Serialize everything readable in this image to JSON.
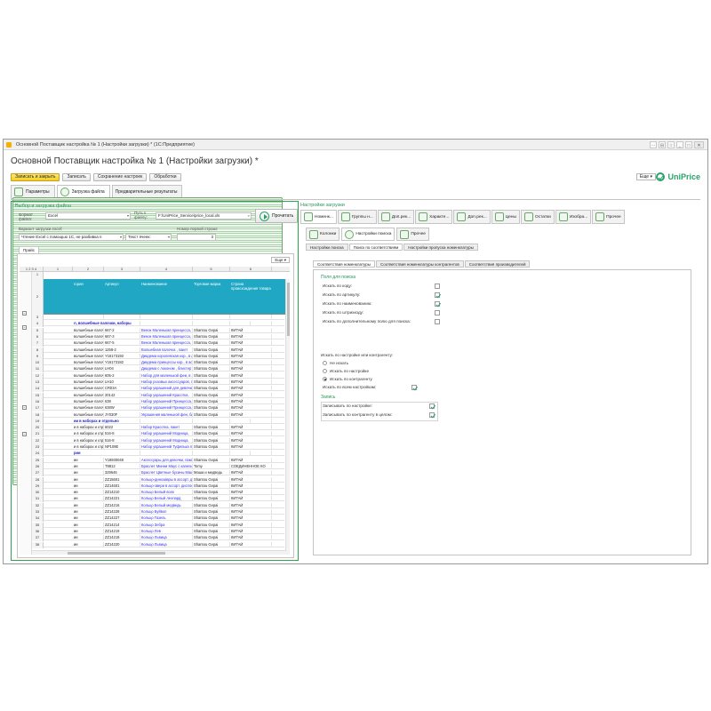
{
  "window": {
    "title": "Основной Поставщик настройка № 1 (Настройки загрузки) * (1С:Предприятие)",
    "controls": [
      "⋯",
      "⊟",
      "☆",
      "_",
      "□",
      "✕"
    ]
  },
  "doc_title": "Основной Поставщик настройка № 1 (Настройки загрузки) *",
  "toolbar": {
    "save_close": "Записать и закрыть",
    "save": "Записать",
    "save_settings": "Сохранение настроек",
    "processing": "Обработки",
    "more": "Еще"
  },
  "logo": {
    "text": "UniPrice",
    "color": "#2aa36a"
  },
  "main_tabs": [
    {
      "label": "Параметры"
    },
    {
      "label": "Загрузка файла"
    },
    {
      "label": "Предварительные результаты"
    }
  ],
  "left": {
    "title": "Выбор и загрузка файла",
    "format_label": "Формат файла:",
    "format_value": "Excel",
    "path_label": "Путь к файлу:",
    "path_value": "F:\\UniPrice_Service\\price_local.xls",
    "load_button": "Прочитать",
    "variant_label": "Вариант загрузки excel:",
    "variant_value": "Чтение Excel с помощью 1С, не разбивка п",
    "text_label": "Текст ячеек:",
    "first_row_label": "Номер первой строки:",
    "first_row_value": "3",
    "sheet_tab": "Прайс",
    "more": "Еще",
    "col_headers": [
      "1",
      "2",
      "3",
      "4",
      "5",
      "6"
    ],
    "level_buttons": "1 2 3 4",
    "header_cells": [
      "гория",
      "Артикул",
      "Наименование",
      "Торговая марка",
      "Страна происхождения товара"
    ],
    "rows": [
      {
        "n": "1",
        "cells": [
          "",
          "",
          "",
          "",
          ""
        ]
      },
      {
        "n": "3",
        "cells": [
          "",
          "",
          "",
          "",
          ""
        ]
      },
      {
        "n": "4",
        "cells": [
          "л, волшебные палочки, наборы",
          "",
          "",
          "",
          ""
        ],
        "group": true
      },
      {
        "n": "5",
        "cells": [
          "волшебные палочк",
          "667-2",
          "Венок Маленькая принцесса,",
          "Shantou Gepai",
          "КИТАЙ"
        ]
      },
      {
        "n": "6",
        "cells": [
          "волшебные палочк",
          "667-3",
          "Венок Маленькая принцесса,",
          "Shantou Gepai",
          "КИТАЙ"
        ]
      },
      {
        "n": "7",
        "cells": [
          "волшебные палочк",
          "667-5",
          "Венок Маленькая принцесса,",
          "Shantou Gepai",
          "КИТАЙ"
        ]
      },
      {
        "n": "8",
        "cells": [
          "волшебные палочк",
          "1258-2",
          "Волшебная палочка , пакет",
          "Shantou Gepai",
          "КИТАЙ"
        ]
      },
      {
        "n": "9",
        "cells": [
          "волшебные палочк",
          "Y16173193",
          "Диадема королевская кор., в ассор",
          "Shantou Gepai",
          "КИТАЙ"
        ]
      },
      {
        "n": "10",
        "cells": [
          "волшебные палочк",
          "Y16173182",
          "Диадема принцессы кор., в ассор",
          "Shantou Gepai",
          "КИТАЙ"
        ]
      },
      {
        "n": "11",
        "cells": [
          "волшебные палочк",
          "LH04",
          "Диадема с локоном , блистер",
          "Shantou Gepai",
          "КИТАЙ"
        ]
      },
      {
        "n": "12",
        "cells": [
          "волшебные палочк",
          "605-2",
          "Набор для маленькой феи, в ассо",
          "Shantou Gepai",
          "КИТАЙ"
        ]
      },
      {
        "n": "13",
        "cells": [
          "волшебные палочк",
          "LH10",
          "Набор розовых аксессуаров, пакет",
          "Shantou Gepai",
          "КИТАЙ"
        ]
      },
      {
        "n": "14",
        "cells": [
          "волшебные палочк",
          "CR03A",
          "Набор украшений для девочки, бл",
          "Shantou Gepai",
          "КИТАЙ"
        ]
      },
      {
        "n": "15",
        "cells": [
          "волшебные палочк",
          "20142",
          "Набор украшений Красотка,",
          "Shantou Gepai",
          "КИТАЙ"
        ]
      },
      {
        "n": "16",
        "cells": [
          "волшебные палочк",
          "638",
          "Набор украшений Принцесса,",
          "Shantou Gepai",
          "КИТАЙ"
        ]
      },
      {
        "n": "17",
        "cells": [
          "волшебные палочк",
          "638W",
          "Набор украшений Принцесса,",
          "Shantou Gepai",
          "КИТАЙ"
        ]
      },
      {
        "n": "18",
        "cells": [
          "волшебные палочк",
          "JY030F",
          "Украшения маленькой феи, блист",
          "Shantou Gepai",
          "КИТАЙ"
        ]
      },
      {
        "n": "19",
        "cells": [
          "ии в наборах и отдельно",
          "",
          "",
          "",
          ""
        ],
        "group": true
      },
      {
        "n": "20",
        "cells": [
          "и в наборах и отдел",
          "6022",
          "Набор Красотка, пакет",
          "Shantou Gepai",
          "КИТАЙ"
        ]
      },
      {
        "n": "21",
        "cells": [
          "и в наборах и отдел",
          "516-8",
          "Набор украшений Модница,",
          "Shantou Gepai",
          "КИТАЙ"
        ]
      },
      {
        "n": "22",
        "cells": [
          "и в наборах и отдел",
          "516-8",
          "Набор украшений Модница,",
          "Shantou Gepai",
          "КИТАЙ"
        ]
      },
      {
        "n": "23",
        "cells": [
          "и в наборах и отдел",
          "NP109E",
          "Набор украшений Туфелька прин",
          "Shantou Gepai",
          "КИТАЙ"
        ]
      },
      {
        "n": "24",
        "cells": [
          "рии",
          "",
          "",
          "",
          ""
        ],
        "group": true
      },
      {
        "n": "25",
        "cells": [
          "ии",
          "Y18930048",
          "Аксессуары для девочки, пакет",
          "Shantou Gepai",
          "КИТАЙ"
        ]
      },
      {
        "n": "26",
        "cells": [
          "ии",
          "T8812",
          "Браслет Минни Маус с капелькой,",
          "Tomy",
          "СОЕДИНЕННОЕ КО"
        ]
      },
      {
        "n": "27",
        "cells": [
          "ии",
          "329646",
          "Браслет Цветные бусины Маша и",
          "Маша и медведь",
          "КИТАЙ"
        ]
      },
      {
        "n": "28",
        "cells": [
          "ии",
          "ZZ15601",
          "Кольцо-динозавры в ассорт. диспл",
          "Shantou Gepai",
          "КИТАЙ"
        ]
      },
      {
        "n": "29",
        "cells": [
          "ии",
          "ZZ14601",
          "Кольцо-звери в ассорт. дисплей, Ш",
          "Shantou Gepai",
          "КИТАЙ"
        ]
      },
      {
        "n": "30",
        "cells": [
          "ии",
          "ZZ14210",
          "Кольцо Белый волк",
          "Shantou Gepai",
          "КИТАЙ"
        ]
      },
      {
        "n": "31",
        "cells": [
          "ии",
          "ZZ14221",
          "Кольцо Белый леопард",
          "Shantou Gepai",
          "КИТАЙ"
        ]
      },
      {
        "n": "32",
        "cells": [
          "ии",
          "ZZ14216",
          "Кольцо Белый медведь",
          "Shantou Gepai",
          "КИТАЙ"
        ]
      },
      {
        "n": "33",
        "cells": [
          "ии",
          "ZZ14228",
          "Кольцо Буйвол",
          "Shantou Gepai",
          "КИТАЙ"
        ]
      },
      {
        "n": "34",
        "cells": [
          "ии",
          "ZZ14227",
          "Кольцо Газель",
          "Shantou Gepai",
          "КИТАЙ"
        ]
      },
      {
        "n": "35",
        "cells": [
          "ии",
          "ZZ14214",
          "Кольцо Зебра",
          "Shantou Gepai",
          "КИТАЙ"
        ]
      },
      {
        "n": "36",
        "cells": [
          "ии",
          "ZZ14219",
          "Кольцо Лев",
          "Shantou Gepai",
          "КИТАЙ"
        ]
      },
      {
        "n": "37",
        "cells": [
          "ии",
          "ZZ14218",
          "Кольцо Львица",
          "Shantou Gepai",
          "КИТАЙ"
        ]
      },
      {
        "n": "38",
        "cells": [
          "ии",
          "ZZ14220",
          "Кольцо Львица",
          "Shantou Gepai",
          "КИТАЙ"
        ]
      }
    ]
  },
  "right": {
    "title": "Настройки загрузки",
    "tabs": [
      "Номенк...",
      "Группы н...",
      "Доп.рек...",
      "Характе...",
      "Доп.рек...",
      "Цены",
      "Остатки",
      "Изобра...",
      "Прочее"
    ],
    "subtabs": [
      "Колонки",
      "Настройки поиска",
      "Прочее"
    ],
    "search_tabs": [
      "Настройки поиска",
      "Поиск по соответствиям",
      "Настройки пропуска номенклатуры"
    ],
    "match_tabs": [
      "Соответствия номенклатуры",
      "Соответствия номенклатуры контрагентов",
      "Соответствия производителей"
    ],
    "fields_head": "Поля для поиска",
    "checks": [
      {
        "label": "Искать по коду:",
        "on": false
      },
      {
        "label": "Искать по артикулу:",
        "on": true
      },
      {
        "label": "Искать по наименованию:",
        "on": true
      },
      {
        "label": "Искать по штрихкоду:",
        "on": false
      },
      {
        "label": "Искать по дополнительному полю для поиска:",
        "on": false
      }
    ],
    "contractor_label": "Искать по настройке или контрагенту:",
    "radios": [
      {
        "label": "Не искать",
        "on": false
      },
      {
        "label": "Искать по настройке",
        "on": false
      },
      {
        "label": "Искать по контрагенту",
        "on": true
      }
    ],
    "all_settings_label": "Искать по всем настройкам:",
    "write_head": "Запись",
    "write_checks": [
      {
        "label": "Записывать по настройке:",
        "on": true
      },
      {
        "label": "Записывать по контрагенту в целом:",
        "on": true
      }
    ]
  }
}
